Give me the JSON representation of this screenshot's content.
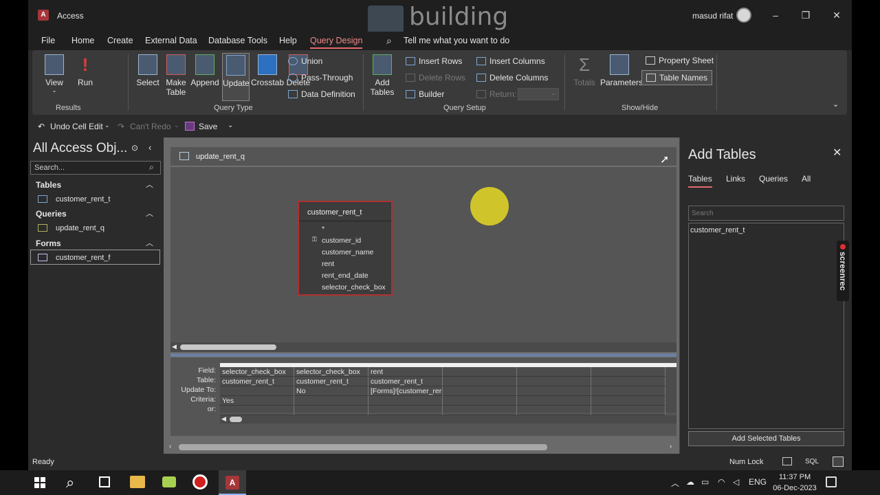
{
  "window": {
    "app_logo": "A",
    "app_title": "Access",
    "watermark": "building",
    "user_name": "masud rifat",
    "controls": {
      "minimize": "–",
      "maximize": "❐",
      "close": "✕"
    }
  },
  "menu": {
    "tabs": [
      "File",
      "Home",
      "Create",
      "External Data",
      "Database Tools",
      "Help",
      "Query Design"
    ],
    "active_tab": "Query Design",
    "tell_me_icon": "⌕",
    "tell_me": "Tell me what you want to do"
  },
  "ribbon": {
    "results": {
      "group_label": "Results",
      "view": "View",
      "run": "Run",
      "run_glyph": "!"
    },
    "query_type": {
      "group_label": "Query Type",
      "select": "Select",
      "make_table": [
        "Make",
        "Table"
      ],
      "append": "Append",
      "update": "Update",
      "crosstab": "Crosstab",
      "delete": "Delete",
      "union": "Union",
      "pass_through": "Pass-Through",
      "data_definition": "Data Definition"
    },
    "query_setup": {
      "group_label": "Query Setup",
      "add_tables": [
        "Add",
        "Tables"
      ],
      "insert_rows": "Insert Rows",
      "delete_rows": "Delete Rows",
      "builder": "Builder",
      "insert_columns": "Insert Columns",
      "delete_columns": "Delete Columns",
      "return": "Return:"
    },
    "show_hide": {
      "group_label": "Show/Hide",
      "totals": "Totals",
      "totals_glyph": "Σ",
      "parameters": "Parameters",
      "property_sheet": "Property Sheet",
      "table_names": "Table Names"
    }
  },
  "qat": {
    "undo": "Undo Cell Edit",
    "redo": "Can't Redo",
    "save": "Save"
  },
  "nav": {
    "title": "All Access Obj...",
    "search_placeholder": "Search...",
    "sections": [
      {
        "label": "Tables",
        "items": [
          "customer_rent_t"
        ]
      },
      {
        "label": "Queries",
        "items": [
          "update_rent_q"
        ]
      },
      {
        "label": "Forms",
        "items": [
          "customer_rent_f"
        ]
      }
    ]
  },
  "document": {
    "tab_title": "update_rent_q",
    "table_box": {
      "name": "customer_rent_t",
      "fields": [
        "*",
        "customer_id",
        "customer_name",
        "rent",
        "rent_end_date",
        "selector_check_box"
      ]
    },
    "grid": {
      "row_labels": [
        "Field:",
        "Table:",
        "Update To:",
        "Criteria:",
        "or:"
      ],
      "columns": [
        {
          "field": "selector_check_box",
          "table": "customer_rent_t",
          "update_to": "",
          "criteria": "Yes",
          "or": ""
        },
        {
          "field": "selector_check_box",
          "table": "customer_rent_t",
          "update_to": "No",
          "criteria": "",
          "or": ""
        },
        {
          "field": "rent",
          "table": "customer_rent_t",
          "update_to": "[Forms]![customer_rer",
          "criteria": "",
          "or": ""
        },
        {
          "field": "",
          "table": "",
          "update_to": "",
          "criteria": "",
          "or": ""
        },
        {
          "field": "",
          "table": "",
          "update_to": "",
          "criteria": "",
          "or": ""
        },
        {
          "field": "",
          "table": "",
          "update_to": "",
          "criteria": "",
          "or": ""
        }
      ]
    }
  },
  "add_tables": {
    "title": "Add Tables",
    "close": "✕",
    "tabs": [
      "Tables",
      "Links",
      "Queries",
      "All"
    ],
    "active_tab": "Tables",
    "search_placeholder": "Search",
    "list_items": [
      "customer_rent_t"
    ],
    "add_button": "Add Selected Tables",
    "screenrec": "screenrec"
  },
  "status": {
    "ready": "Ready",
    "num_lock": "Num Lock",
    "sql": "SQL"
  },
  "taskbar": {
    "lang": "ENG",
    "time": "11:37 PM",
    "date": "06-Dec-2023"
  },
  "colors": {
    "accent": "#e66a6d",
    "highlight": "#cfc52a",
    "table_border": "#b03030"
  }
}
